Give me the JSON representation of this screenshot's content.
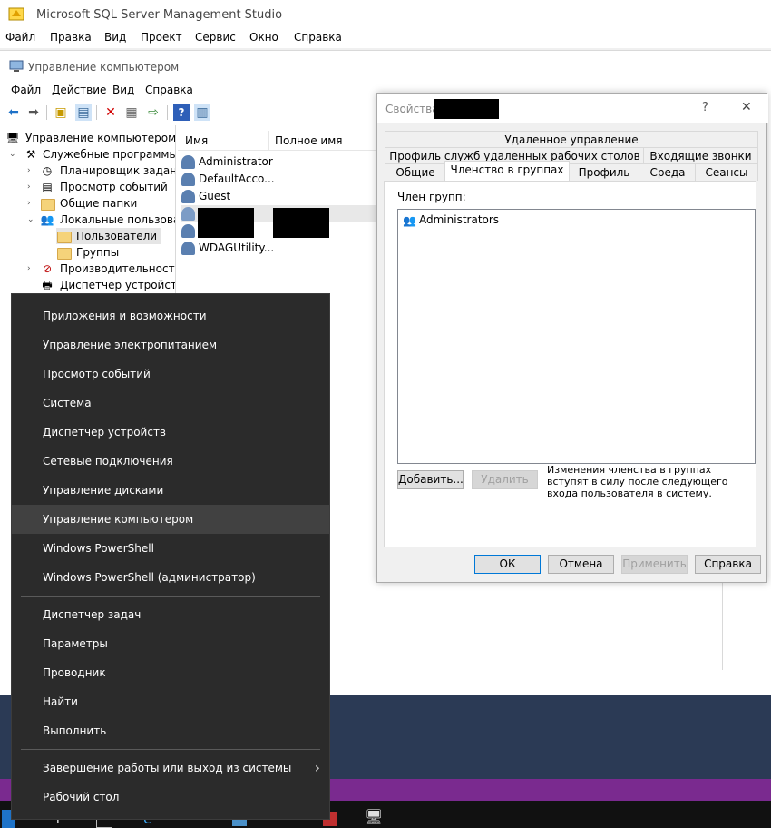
{
  "ssms": {
    "title": "Microsoft SQL Server Management Studio",
    "menu": [
      "Файл",
      "Правка",
      "Вид",
      "Проект",
      "Сервис",
      "Окно",
      "Справка"
    ]
  },
  "cm": {
    "title": "Управление компьютером",
    "menu": [
      "Файл",
      "Действие",
      "Вид",
      "Справка"
    ],
    "tree": {
      "root": "Управление компьютером (л",
      "utilities": "Служебные программы",
      "scheduler": "Планировщик заданий",
      "event_viewer": "Просмотр событий",
      "shared_folders": "Общие папки",
      "local_users": "Локальные пользовате",
      "users": "Пользователи",
      "groups": "Группы",
      "performance": "Производительность",
      "device_manager": "Диспетчер устройств"
    },
    "list": {
      "col_name": "Имя",
      "col_fullname": "Полное имя",
      "rows": [
        "Administrator",
        "DefaultAcco...",
        "Guest",
        "",
        "",
        "WDAGUtility..."
      ]
    }
  },
  "props": {
    "title": "Свойства",
    "tabs_row1": [
      "Удаленное управление"
    ],
    "tabs_row2": [
      "Профиль служб удаленных рабочих столов",
      "Входящие звонки"
    ],
    "tabs_row3": [
      "Общие",
      "Членство в группах",
      "Профиль",
      "Среда",
      "Сеансы"
    ],
    "member_of_label": "Член групп:",
    "groups": [
      "Administrators"
    ],
    "add_label": "Добавить...",
    "remove_label": "Удалить",
    "note": "Изменения членства в группах вступят в силу после следующего входа пользователя в систему.",
    "ok": "ОК",
    "cancel": "Отмена",
    "apply": "Применить",
    "help": "Справка",
    "help_glyph": "?",
    "close_glyph": "✕"
  },
  "winx": {
    "group1": [
      "Приложения и возможности",
      "Управление электропитанием",
      "Просмотр событий",
      "Система",
      "Диспетчер устройств",
      "Сетевые подключения",
      "Управление дисками",
      "Управление компьютером",
      "Windows PowerShell",
      "Windows PowerShell (администратор)"
    ],
    "group2": [
      "Диспетчер задач",
      "Параметры",
      "Проводник",
      "Найти",
      "Выполнить"
    ],
    "group3": [
      "Завершение работы или выход из системы",
      "Рабочий стол"
    ],
    "highlighted": "Управление компьютером",
    "submenu_glyph": "›"
  },
  "colors": {
    "menu_bg": "#2b2b2b",
    "menu_highlight": "#414141",
    "accent": "#0078d7"
  }
}
